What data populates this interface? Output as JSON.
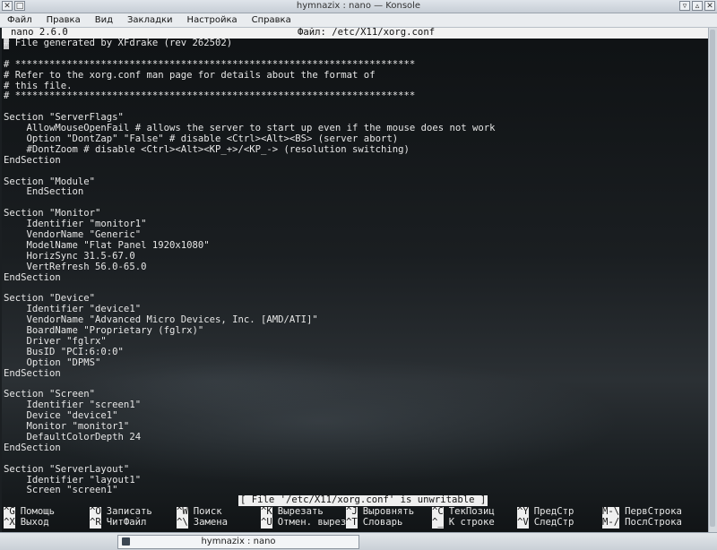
{
  "window": {
    "title": "hymnazix : nano — Konsole",
    "menu": [
      "Файл",
      "Правка",
      "Вид",
      "Закладки",
      "Настройка",
      "Справка"
    ]
  },
  "nano": {
    "version": "nano 2.6.0",
    "file_label": "Файл: /etc/X11/xorg.conf",
    "lines": [
      "# File generated by XFdrake (rev 262502)",
      "",
      "# **********************************************************************",
      "# Refer to the xorg.conf man page for details about the format of",
      "# this file.",
      "# **********************************************************************",
      "",
      "Section \"ServerFlags\"",
      "    AllowMouseOpenFail # allows the server to start up even if the mouse does not work",
      "    Option \"DontZap\" \"False\" # disable <Ctrl><Alt><BS> (server abort)",
      "    #DontZoom # disable <Ctrl><Alt><KP_+>/<KP_-> (resolution switching)",
      "EndSection",
      "",
      "Section \"Module\"",
      "    EndSection",
      "",
      "Section \"Monitor\"",
      "    Identifier \"monitor1\"",
      "    VendorName \"Generic\"",
      "    ModelName \"Flat Panel 1920x1080\"",
      "    HorizSync 31.5-67.0",
      "    VertRefresh 56.0-65.0",
      "EndSection",
      "",
      "Section \"Device\"",
      "    Identifier \"device1\"",
      "    VendorName \"Advanced Micro Devices, Inc. [AMD/ATI]\"",
      "    BoardName \"Proprietary (fglrx)\"",
      "    Driver \"fglrx\"",
      "    BusID \"PCI:6:0:0\"",
      "    Option \"DPMS\"",
      "EndSection",
      "",
      "Section \"Screen\"",
      "    Identifier \"screen1\"",
      "    Device \"device1\"",
      "    Monitor \"monitor1\"",
      "    DefaultColorDepth 24",
      "EndSection",
      "",
      "Section \"ServerLayout\"",
      "    Identifier \"layout1\"",
      "    Screen \"screen1\""
    ],
    "status": "[ File '/etc/X11/xorg.conf' is unwritable ]",
    "shortcuts": [
      {
        "key": "^G",
        "label": "Помощь"
      },
      {
        "key": "^X",
        "label": "Выход"
      },
      {
        "key": "^O",
        "label": "Записать"
      },
      {
        "key": "^R",
        "label": "ЧитФайл"
      },
      {
        "key": "^W",
        "label": "Поиск"
      },
      {
        "key": "^\\",
        "label": "Замена"
      },
      {
        "key": "^K",
        "label": "Вырезать"
      },
      {
        "key": "^U",
        "label": "Отмен. вырезк"
      },
      {
        "key": "^J",
        "label": "Выровнять"
      },
      {
        "key": "^T",
        "label": "Словарь"
      },
      {
        "key": "^C",
        "label": "ТекПозиц"
      },
      {
        "key": "^_",
        "label": "К строке"
      },
      {
        "key": "^Y",
        "label": "ПредСтр"
      },
      {
        "key": "^V",
        "label": "СледСтр"
      },
      {
        "key": "M-\\",
        "label": "ПервСтрока"
      },
      {
        "key": "M-/",
        "label": "ПослСтрока"
      }
    ]
  },
  "taskbar": {
    "task_label": "hymnazix : nano"
  }
}
